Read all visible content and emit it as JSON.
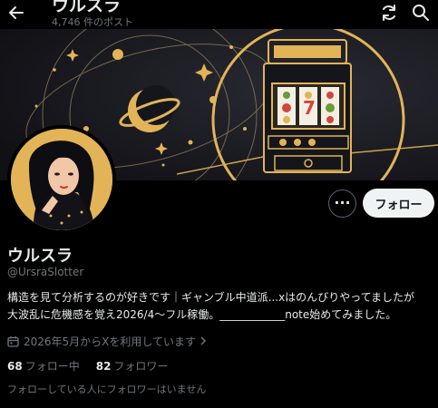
{
  "header": {
    "title": "ウルスラ",
    "post_count": "4,746 件のポスト"
  },
  "profile": {
    "display_name": "ウルスラ",
    "handle": "@UrsraSlotter",
    "bio_line_1": "構造を見て分析するのが好きです｜ギャンブル中道派...xはのんびりやってましたが",
    "bio_line_2": "大波乱に危機感を覚え2026/4～フル稼働。____________note始めてみました。",
    "joined": "2026年5月からXを利用しています",
    "following_count": "68",
    "following_label": "フォロー中",
    "followers_count": "82",
    "followers_label": "フォロワー",
    "no_known_followers": "フォローしている人にフォロワーはいません"
  },
  "actions": {
    "more_label": "···",
    "follow_label": "フォロー"
  },
  "icons": {
    "back": "arrow-left-icon",
    "refresh": "refresh-icon",
    "search": "search-icon",
    "calendar": "calendar-icon",
    "chevron": "chevron-right-icon"
  },
  "colors": {
    "background": "#000000",
    "text_primary": "#e7e9ea",
    "text_secondary": "#71767b",
    "follow_button_bg": "#eff3f4",
    "banner_gold": "#e2b457"
  }
}
